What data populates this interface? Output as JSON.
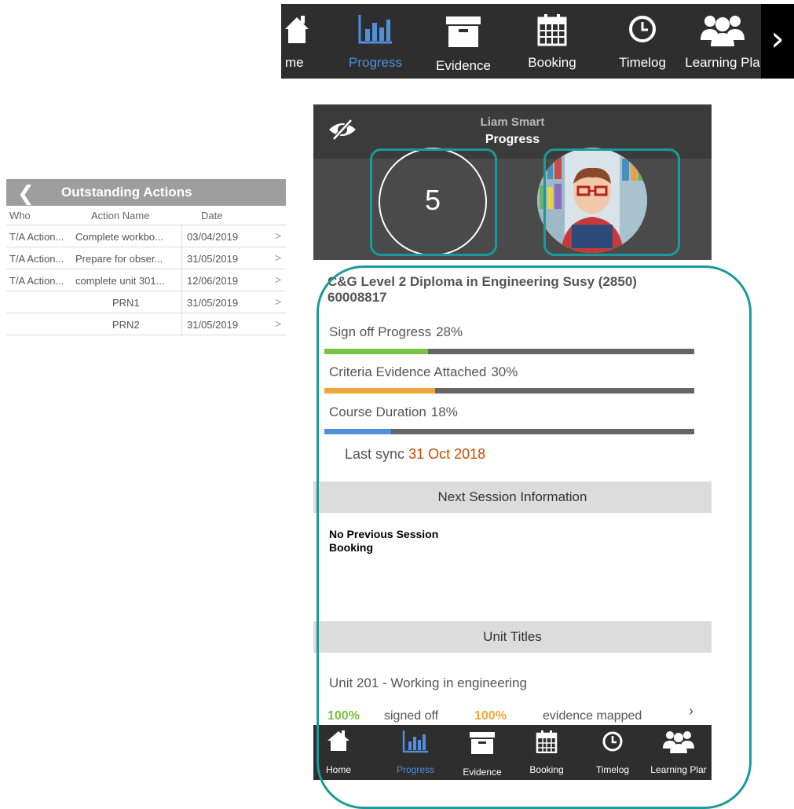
{
  "top_nav": {
    "items": [
      {
        "label": "me",
        "icon": "home-icon"
      },
      {
        "label": "Progress",
        "icon": "progress-chart-icon",
        "active": true
      },
      {
        "label": "Evidence",
        "icon": "archive-box-icon"
      },
      {
        "label": "Booking",
        "icon": "calendar-icon"
      },
      {
        "label": "Timelog",
        "icon": "clock-icon"
      },
      {
        "label": "Learning Pla",
        "icon": "people-icon"
      }
    ],
    "more_icon": "chevron-right-icon"
  },
  "outstanding_actions": {
    "title": "Outstanding Actions",
    "columns": [
      "Who",
      "Action Name",
      "Date"
    ],
    "rows": [
      {
        "who": "T/A Action...",
        "action": "Complete workbo...",
        "date": "03/04/2019"
      },
      {
        "who": "T/A Action...",
        "action": "Prepare for obser...",
        "date": "31/05/2019"
      },
      {
        "who": "T/A Action...",
        "action": "complete unit 301...",
        "date": "12/06/2019"
      },
      {
        "who": "",
        "action": "PRN1",
        "date": "31/05/2019"
      },
      {
        "who": "",
        "action": "PRN2",
        "date": "31/05/2019"
      }
    ]
  },
  "progress_screen": {
    "user_name": "Liam Smart",
    "screen_title": "Progress",
    "count": "5",
    "course": "C&G Level 2 Diploma in Engineering Susy (2850) 60008817",
    "metrics": [
      {
        "label": "Sign off Progress",
        "pct": "28%",
        "value": 28,
        "color": "#7bc142"
      },
      {
        "label": "Criteria Evidence Attached",
        "pct": "30%",
        "value": 30,
        "color": "#f2a53c"
      },
      {
        "label": "Course Duration",
        "pct": "18%",
        "value": 18,
        "color": "#4f8fdc"
      }
    ],
    "last_sync_label": "Last sync",
    "last_sync_date": "31 Oct 2018",
    "next_session_header": "Next Session Information",
    "no_session_line1": "No Previous Session",
    "no_session_line2": "Booking",
    "unit_titles_header": "Unit Titles",
    "unit": {
      "title": "Unit 201 - Working in engineering",
      "signed_off_pct": "100%",
      "signed_off_label": "signed off",
      "evidence_pct": "100%",
      "evidence_label": "evidence mapped"
    },
    "bottom_nav": [
      {
        "label": "Home",
        "icon": "home-icon"
      },
      {
        "label": "Progress",
        "icon": "progress-chart-icon",
        "active": true
      },
      {
        "label": "Evidence",
        "icon": "archive-box-icon"
      },
      {
        "label": "Booking",
        "icon": "calendar-icon"
      },
      {
        "label": "Timelog",
        "icon": "clock-icon"
      },
      {
        "label": "Learning Plar",
        "icon": "people-icon"
      }
    ]
  },
  "colors": {
    "highlight": "#1a9a98",
    "active_tab": "#4f8fdc",
    "sync_date": "#cc4a00"
  }
}
